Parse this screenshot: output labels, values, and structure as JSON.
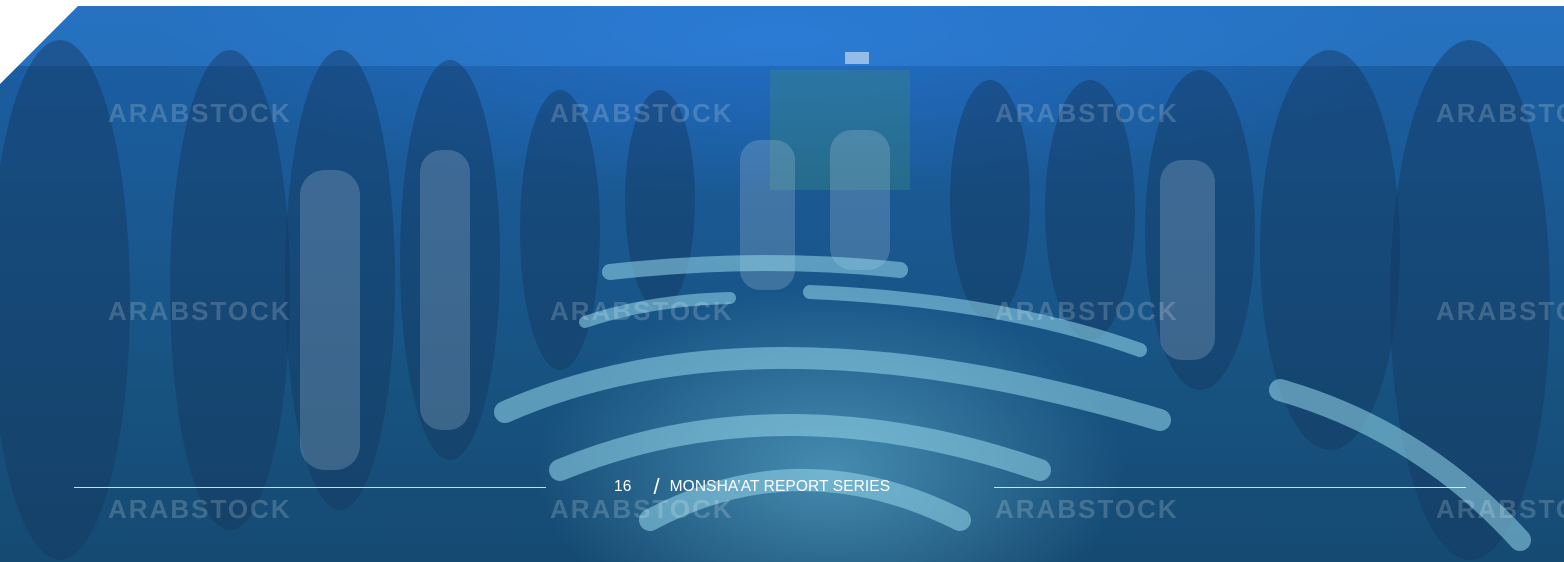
{
  "footer": {
    "page_number": "16",
    "separator": "/",
    "series_title": "MONSHA’AT REPORT SERIES"
  },
  "watermark": {
    "text": "ARABSTOCK"
  },
  "colors": {
    "overlay_blue": "#1a5a96",
    "rule_color": "#ebf5ff",
    "text_color": "#ffffff"
  }
}
